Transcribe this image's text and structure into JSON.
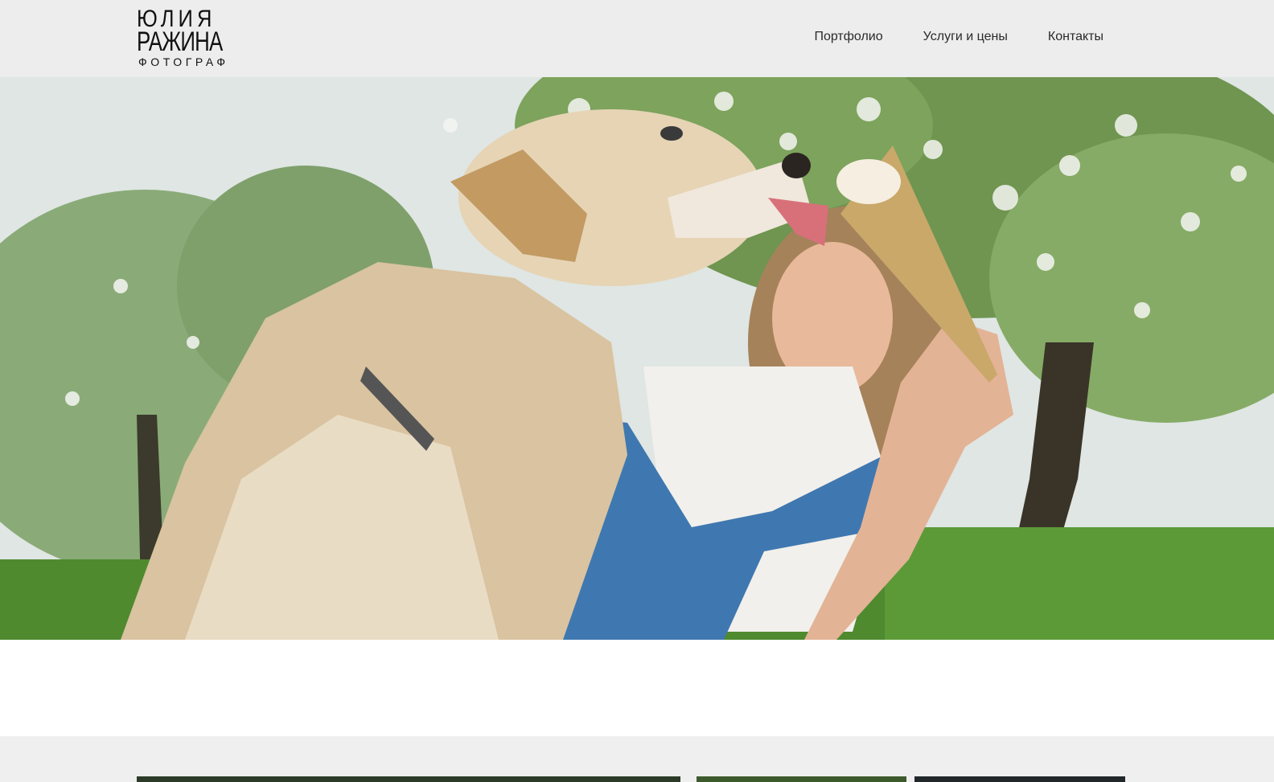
{
  "header": {
    "logo": {
      "line1": "ЮЛИЯ",
      "line2": "РАЖИНА",
      "line3": "ФОТОГРАФ"
    },
    "nav": [
      {
        "label": "Портфолио"
      },
      {
        "label": "Услуги и цены"
      },
      {
        "label": "Контакты"
      }
    ]
  },
  "colors": {
    "header_bg": "#ededed",
    "gallery_bg": "#efefef",
    "text": "#2a2a2a"
  },
  "hero": {
    "image": "photo-golden-retriever-licking-ice-cream-woman-blossom-trees"
  },
  "gallery": {
    "thumbnails": [
      "thumb-1",
      "thumb-2",
      "thumb-3"
    ]
  }
}
